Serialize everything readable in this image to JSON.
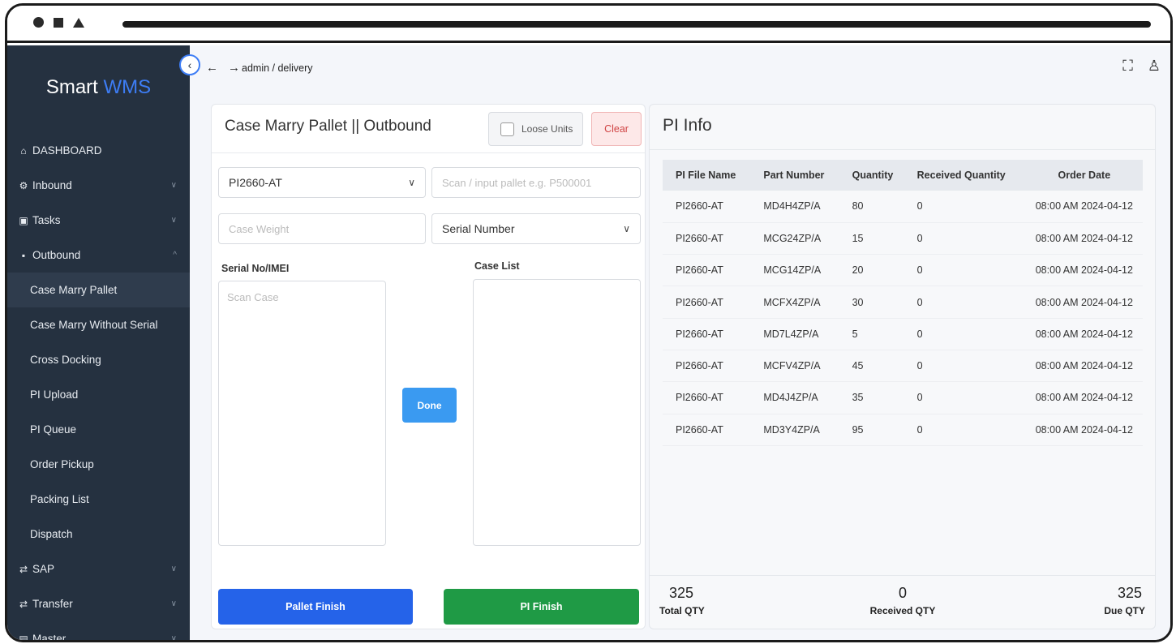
{
  "app": {
    "brand_main": "Smart",
    "brand_accent": "WMS"
  },
  "sidebar": {
    "items": [
      {
        "label": "DASHBOARD",
        "icon": "home-icon",
        "glyph": "⌂",
        "expandable": false
      },
      {
        "label": "Inbound",
        "icon": "settings-icon",
        "glyph": "⚙",
        "expandable": true,
        "expanded": false
      },
      {
        "label": "Tasks",
        "icon": "clipboard-icon",
        "glyph": "▣",
        "expandable": true,
        "expanded": false
      },
      {
        "label": "Outbound",
        "icon": "box-icon",
        "glyph": "▪",
        "expandable": true,
        "expanded": true
      }
    ],
    "outbound_subitems": [
      {
        "label": "Case Marry Pallet",
        "active": true
      },
      {
        "label": "Case Marry Without Serial"
      },
      {
        "label": "Cross Docking"
      },
      {
        "label": "PI Upload"
      },
      {
        "label": "PI Queue"
      },
      {
        "label": "Order Pickup"
      },
      {
        "label": "Packing List"
      },
      {
        "label": "Dispatch"
      }
    ],
    "bottom_items": [
      {
        "label": "SAP",
        "icon": "swap-icon",
        "glyph": "⇄"
      },
      {
        "label": "Transfer",
        "icon": "swap-icon",
        "glyph": "⇄"
      },
      {
        "label": "Master",
        "icon": "list-icon",
        "glyph": "▤"
      }
    ]
  },
  "topbar": {
    "breadcrumb": "admin / delivery",
    "back_glyph": "←",
    "forward_glyph": "→",
    "fullscreen_glyph": "⛶",
    "user_glyph": "♙"
  },
  "left_panel": {
    "title": "Case Marry Pallet || Outbound",
    "loose_units_label": "Loose Units",
    "clear_label": "Clear",
    "pi_select_value": "PI2660-AT",
    "pallet_placeholder": "Scan / input pallet e.g. P500001",
    "case_weight_placeholder": "Case Weight",
    "serial_select_value": "Serial Number",
    "serial_label": "Serial No/IMEI",
    "scan_case_placeholder": "Scan Case",
    "case_list_label": "Case List",
    "done_label": "Done",
    "pallet_finish_label": "Pallet Finish",
    "pi_finish_label": "PI Finish"
  },
  "pi_info": {
    "title": "PI Info",
    "columns": [
      "PI File Name",
      "Part Number",
      "Quantity",
      "Received Quantity",
      "Order Date"
    ],
    "rows": [
      [
        "PI2660-AT",
        "MD4H4ZP/A",
        "80",
        "0",
        "08:00 AM 2024-04-12"
      ],
      [
        "PI2660-AT",
        "MCG24ZP/A",
        "15",
        "0",
        "08:00 AM 2024-04-12"
      ],
      [
        "PI2660-AT",
        "MCG14ZP/A",
        "20",
        "0",
        "08:00 AM 2024-04-12"
      ],
      [
        "PI2660-AT",
        "MCFX4ZP/A",
        "30",
        "0",
        "08:00 AM 2024-04-12"
      ],
      [
        "PI2660-AT",
        "MD7L4ZP/A",
        "5",
        "0",
        "08:00 AM 2024-04-12"
      ],
      [
        "PI2660-AT",
        "MCFV4ZP/A",
        "45",
        "0",
        "08:00 AM 2024-04-12"
      ],
      [
        "PI2660-AT",
        "MD4J4ZP/A",
        "35",
        "0",
        "08:00 AM 2024-04-12"
      ],
      [
        "PI2660-AT",
        "MD3Y4ZP/A",
        "95",
        "0",
        "08:00 AM 2024-04-12"
      ]
    ],
    "totals": {
      "total_qty": "325",
      "total_label": "Total QTY",
      "received_qty": "0",
      "received_label": "Received QTY",
      "due_qty": "325",
      "due_label": "Due QTY"
    }
  },
  "colors": {
    "sidebar_bg": "#253140",
    "brand_accent": "#3d7df5",
    "pallet_finish": "#2563e9",
    "pi_finish": "#1f9a45",
    "done": "#3a9af1",
    "clear": "#d04444"
  }
}
